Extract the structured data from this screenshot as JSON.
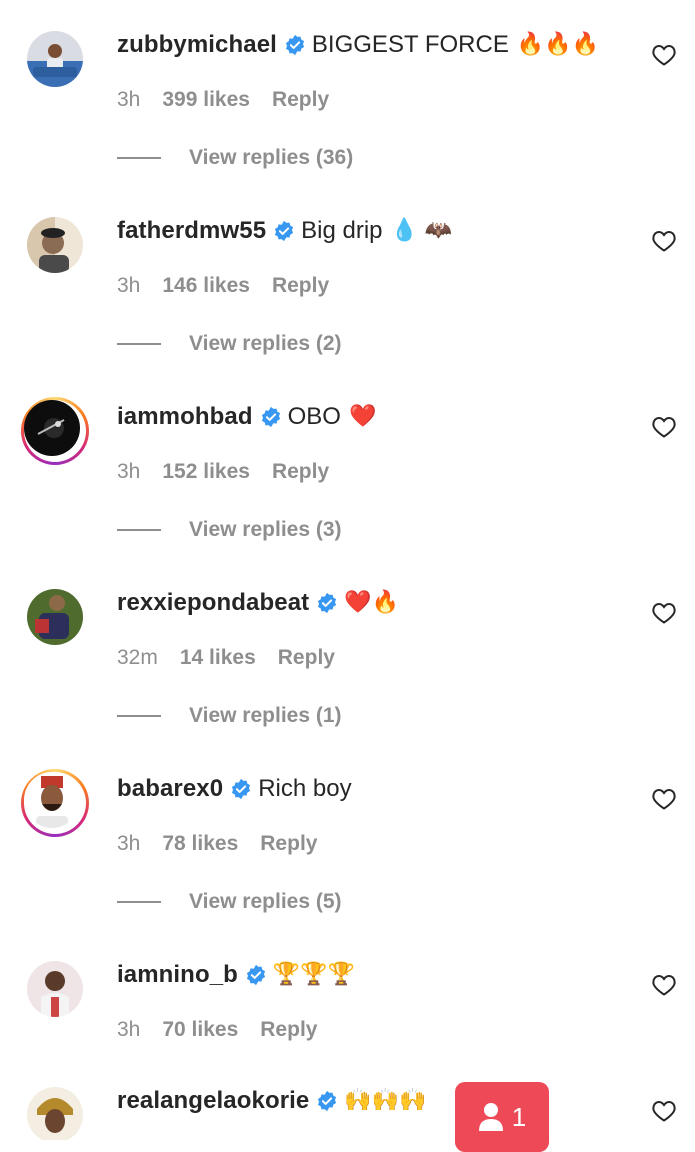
{
  "comments": [
    {
      "username": "zubbymichael",
      "text": "BIGGEST FORCE",
      "emoji": "🔥🔥🔥",
      "time": "3h",
      "likes": "399 likes",
      "reply": "Reply",
      "view_replies": "View replies (36)",
      "avatar_icon": "avatar-photo",
      "story_ring": false
    },
    {
      "username": "fatherdmw55",
      "text": "Big drip",
      "emoji": "💧 🦇",
      "time": "3h",
      "likes": "146 likes",
      "reply": "Reply",
      "view_replies": "View replies (2)",
      "avatar_icon": "avatar-photo",
      "story_ring": false
    },
    {
      "username": "iammohbad",
      "text": "OBO",
      "emoji": "❤️",
      "time": "3h",
      "likes": "152 likes",
      "reply": "Reply",
      "view_replies": "View replies (3)",
      "avatar_icon": "avatar-photo",
      "story_ring": true
    },
    {
      "username": "rexxiepondabeat",
      "text": "",
      "emoji": "❤️🔥",
      "time": "32m",
      "likes": "14 likes",
      "reply": "Reply",
      "view_replies": "View replies (1)",
      "avatar_icon": "avatar-photo",
      "story_ring": false
    },
    {
      "username": "babarex0",
      "text": "Rich boy",
      "emoji": "",
      "time": "3h",
      "likes": "78 likes",
      "reply": "Reply",
      "view_replies": "View replies (5)",
      "avatar_icon": "avatar-photo",
      "story_ring": true
    },
    {
      "username": "iamnino_b",
      "text": "",
      "emoji": "🏆🏆🏆",
      "time": "3h",
      "likes": "70 likes",
      "reply": "Reply",
      "view_replies": "",
      "avatar_icon": "avatar-photo",
      "story_ring": false
    },
    {
      "username": "realangelaokorie",
      "text": "",
      "emoji": "🙌🙌🙌",
      "time": "",
      "likes": "",
      "reply": "",
      "view_replies": "",
      "avatar_icon": "avatar-photo",
      "story_ring": false
    }
  ],
  "new_followers_badge": {
    "count": "1",
    "icon": "person-icon"
  },
  "colors": {
    "verified": "#3897f0",
    "muted_text": "#8e8e8e",
    "primary_text": "#262626",
    "badge": "#ed4956",
    "story_ring": [
      "#feda75",
      "#fa7e1e",
      "#d62976",
      "#962fbf"
    ]
  }
}
